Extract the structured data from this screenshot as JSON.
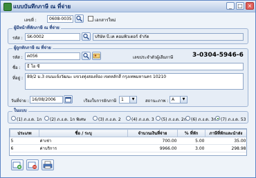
{
  "window": {
    "title": "แบบบันทึกภาษี ณ ที่จ่าย",
    "minimize": "_",
    "maximize": "□",
    "close": "×"
  },
  "doc": {
    "number_label": "เลขที่ :",
    "number_value": "0608-0035",
    "new_doc_label": "เอกสารใหม่"
  },
  "payer": {
    "title": "ผู้มีหน้าที่หักภาษี ณ ที่จ่าย",
    "code_label": "รหัส :",
    "code_value": "SK-0002",
    "name_value": "บริษัท บี.เค คอมพิวเตอร์ จำกัด"
  },
  "payee": {
    "title": "ผู้ถูกหักภาษี ณ ที่จ่าย",
    "code_label": "รหัส :",
    "code_value": "ค056",
    "taxid_label": "เลขประจำตัวผู้เสียภาษี",
    "taxid_value": "3-0304-5946-6",
    "name_label": "ชื่อ :",
    "name_value": "ธี โอ ซี",
    "addr_label": "ที่อยู่ :",
    "addr_value": "89/2 ม.3 ถนนแจ้งวัฒนะ แขวงทุ่งสองห้อง เขตหลักสี่ กรุงเทพมหานคร 10210",
    "date_label": "วันที่จ่าย :",
    "date_value": "16/08/2006",
    "order_label": "เรียงใบการยักภาษี",
    "order_value": "1",
    "status_label": "สถานะภาพ :",
    "status_value": "A"
  },
  "form_type": {
    "title": "ในแบบ",
    "options": [
      "(1) ภ.ง.ด. 1ก",
      "(2) ภ.ง.ด. 1ก พิเศษ",
      "(3) ภ.ง.ด. 2",
      "(4) ภ.ง.ด. 3",
      "(5) ภ.ง.ด. 2ก",
      "(6) ภ.ง.ด. 3ก",
      "(7) ภ.ง.ด. 53"
    ]
  },
  "grid": {
    "headers": [
      "ประเภท",
      "ชื่อ / ระบุ",
      "จำนวนเงินที่จ่าย",
      "% ที่หัก",
      "ภาษีที่หักและนำส่ง"
    ],
    "rows": [
      [
        "5",
        "ค่าเช่า",
        "700.00",
        "5.00",
        "35.00"
      ],
      [
        "6",
        "ค่าบริการ",
        "9966.00",
        "3.00",
        "298.98"
      ]
    ]
  },
  "toolbar": {
    "icons": [
      "add-record-icon",
      "delete-record-icon",
      "print-icon"
    ]
  },
  "colors": {
    "accent": "#1b3a78",
    "window_border": "#5b84c4",
    "panel": "#e6edf6"
  }
}
